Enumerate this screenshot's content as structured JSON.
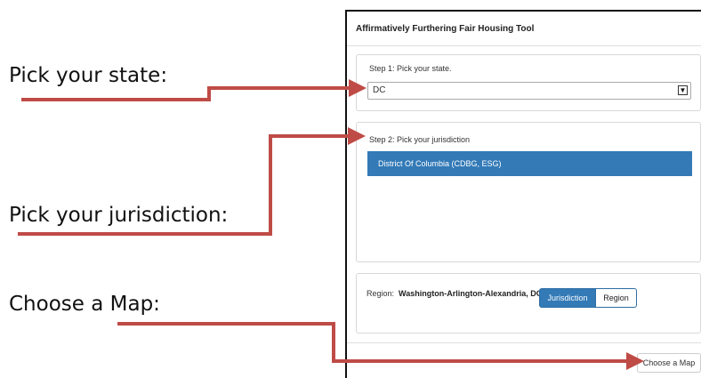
{
  "callouts": {
    "state": "Pick your state:",
    "jurisdiction": "Pick your jurisdiction:",
    "map": "Choose a Map:"
  },
  "tool": {
    "title": "Affirmatively Furthering Fair Housing Tool",
    "step1": {
      "label": "Step 1: Pick your state.",
      "selected": "DC"
    },
    "step2": {
      "label": "Step 2: Pick your jurisdiction",
      "items": [
        "District Of Columbia (CDBG, ESG)"
      ]
    },
    "region": {
      "label": "Region:",
      "value": "Washington-Arlington-Alexandria, DC-VA-MD-WV"
    },
    "toggle": {
      "jurisdiction": "Jurisdiction",
      "region": "Region"
    },
    "choose_map": "Choose a Map"
  },
  "colors": {
    "arrow": "#bf4b46",
    "accent": "#337ab7"
  }
}
